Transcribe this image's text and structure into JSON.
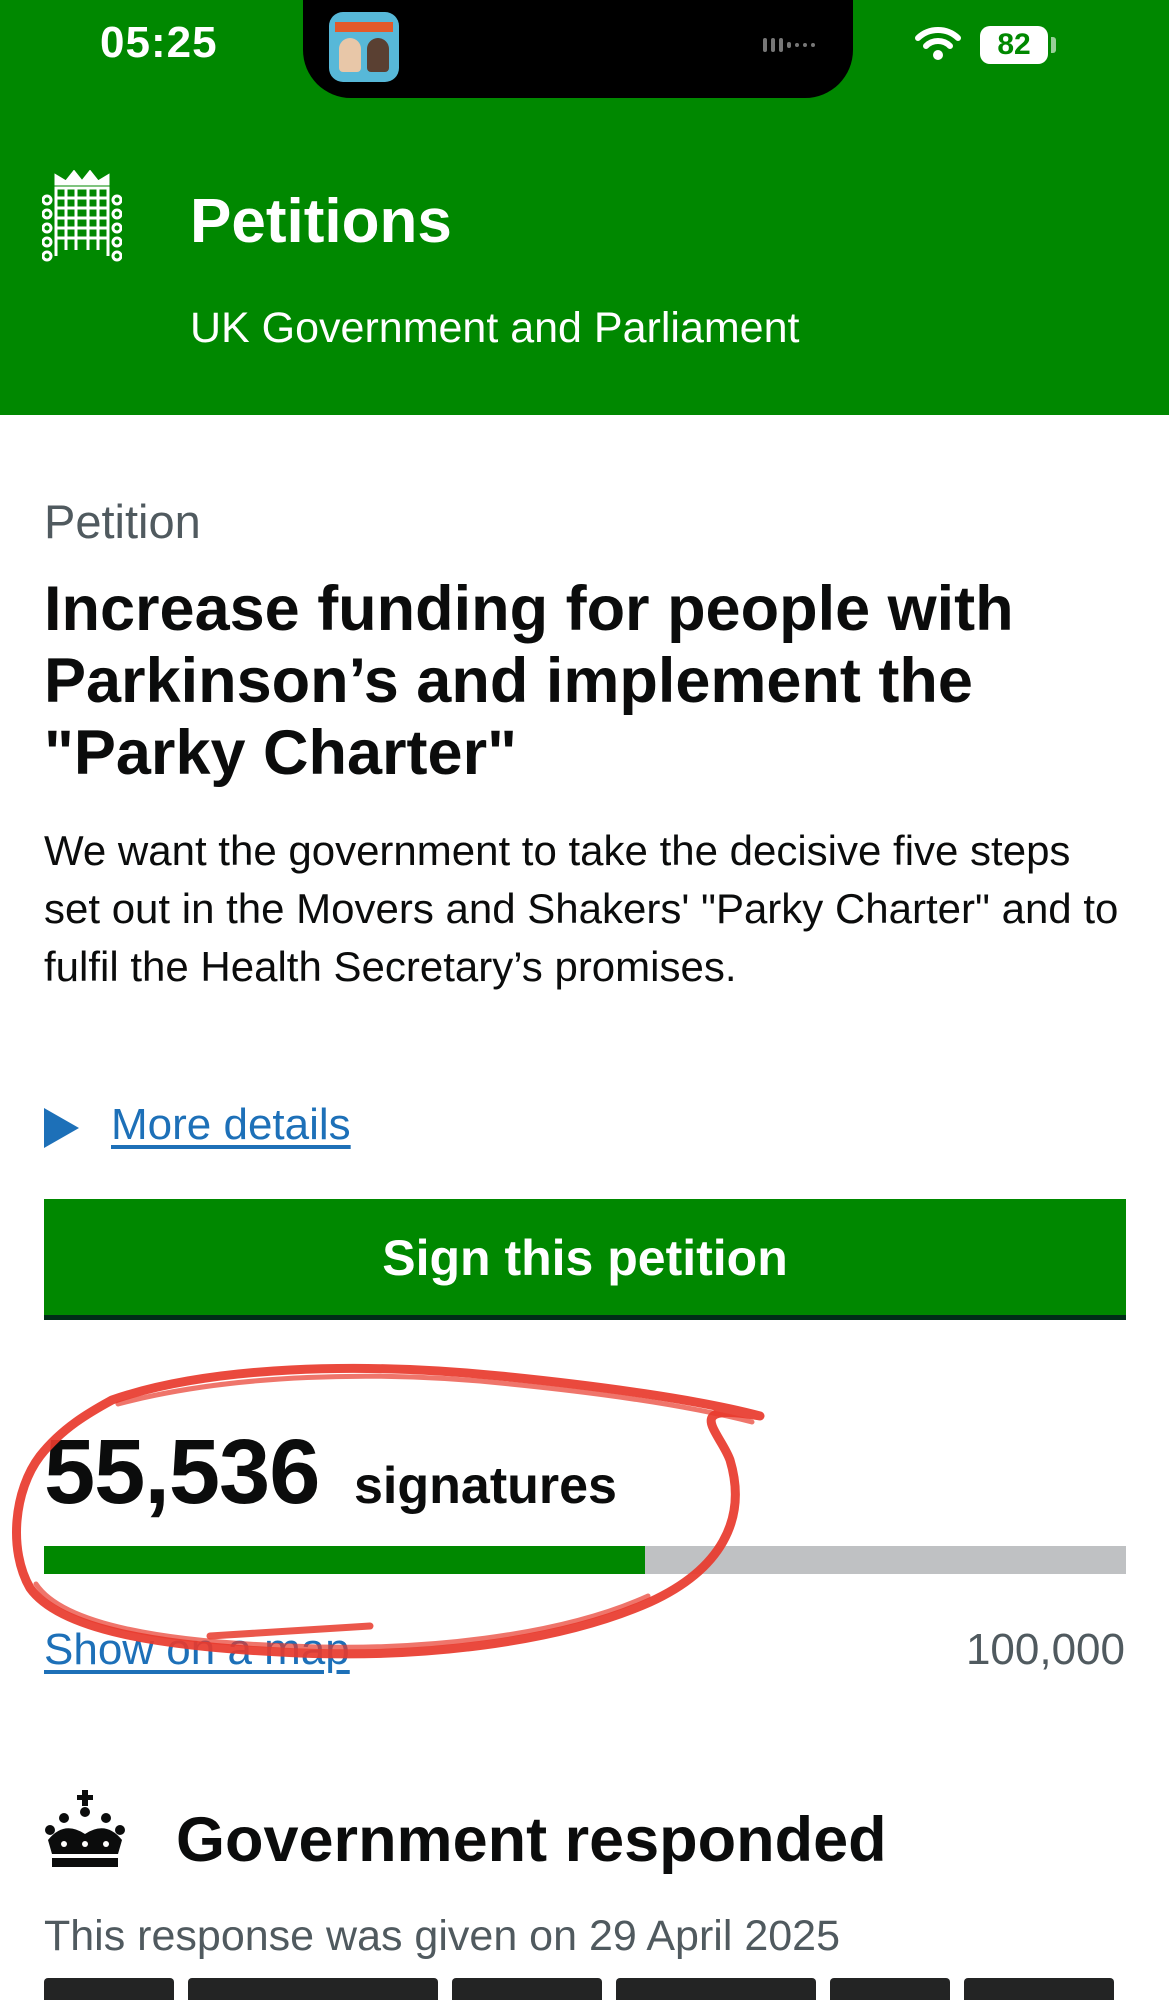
{
  "status_bar": {
    "time": "05:25",
    "battery": "82",
    "icons": [
      "wifi-icon",
      "battery-icon"
    ]
  },
  "header": {
    "logo_icon": "portcullis-icon",
    "title": "Petitions",
    "subtitle": "UK Government and Parliament",
    "background_color": "#008800"
  },
  "petition": {
    "caption": "Petition",
    "title": "Increase funding for people with Parkinson’s and implement the \"Parky Charter\"",
    "summary": "We want the government to take the decisive five steps set out in the Movers and Shakers' \"Parky Charter\" and to fulfil the Health Secretary’s promises.",
    "more_details_label": "More details",
    "sign_button_label": "Sign this petition"
  },
  "signatures": {
    "count": "55,536",
    "label": "signatures",
    "target": "100,000",
    "progress_fraction": 0.5554,
    "map_link_label": "Show on a map"
  },
  "response": {
    "icon": "crown-icon",
    "title": "Government responded",
    "date_text": "This response was given on 29 April 2025"
  },
  "colors": {
    "brand_green": "#008800",
    "link_blue": "#1d70b8",
    "secondary_text": "#505a5f",
    "progress_track": "#bfc1c3",
    "annotation_red": "#e83a2c"
  }
}
